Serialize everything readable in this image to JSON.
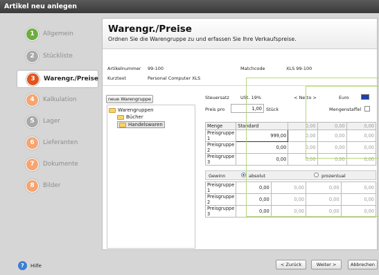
{
  "window": {
    "title": "Artikel neu anlegen"
  },
  "steps": [
    {
      "num": "1",
      "label": "Allgemein",
      "state": "done"
    },
    {
      "num": "2",
      "label": "Stückliste",
      "state": "done-gray"
    },
    {
      "num": "3",
      "label": "Warengr./Preise",
      "state": "active"
    },
    {
      "num": "4",
      "label": "Kalkulation",
      "state": "todo"
    },
    {
      "num": "5",
      "label": "Lager",
      "state": "done-gray"
    },
    {
      "num": "6",
      "label": "Lieferanten",
      "state": "todo"
    },
    {
      "num": "7",
      "label": "Dokumente",
      "state": "todo"
    },
    {
      "num": "8",
      "label": "Bilder",
      "state": "todo"
    }
  ],
  "header": {
    "title": "Warengr./Preise",
    "subtitle": "Ordnen Sie die Warengruppe zu und erfassen Sie Ihre Verkaufspreise."
  },
  "article": {
    "nr_label": "Artikelnummer",
    "nr_value": "99-100",
    "match_label": "Matchcode",
    "match_value": "XLS 99-100",
    "kurz_label": "Kurztext",
    "kurz_value": "Personal Computer XLS"
  },
  "new_group_button": "neue Warengruppe",
  "tree": {
    "root": "Warengruppen",
    "children": [
      "Bücher",
      "Handelswaren"
    ]
  },
  "tax": {
    "label": "Steuersatz",
    "value": "USt. 19%",
    "netto": "< Netto >",
    "currency": "Euro"
  },
  "price_per": {
    "label": "Preis pro",
    "value": "1,00",
    "unit": "Stück",
    "staffel_label": "Mengenstaffel"
  },
  "price_table": {
    "head": [
      "Menge",
      "Standard",
      "0,00",
      "0,00",
      "0,00"
    ],
    "rows": [
      {
        "label": "Preisgruppe 1",
        "values": [
          "999,00",
          "0,00",
          "0,00",
          "0,00"
        ]
      },
      {
        "label": "Preisgruppe 2",
        "values": [
          "0,00",
          "0,00",
          "0,00",
          "0,00"
        ]
      },
      {
        "label": "Preisgruppe 3",
        "values": [
          "0,00",
          "0,00",
          "0,00",
          "0,00"
        ]
      }
    ]
  },
  "profit": {
    "label": "Gewinn",
    "opt_abs": "absolut",
    "opt_pct": "prozentual"
  },
  "profit_table": {
    "rows": [
      {
        "label": "Preisgruppe 1",
        "values": [
          "0,00",
          "0,00",
          "0,00",
          "0,00"
        ]
      },
      {
        "label": "Preisgruppe 2",
        "values": [
          "0,00",
          "0,00",
          "0,00",
          "0,00"
        ]
      },
      {
        "label": "Preisgruppe 3",
        "values": [
          "0,00",
          "0,00",
          "0,00",
          "0,00"
        ]
      }
    ]
  },
  "footer": {
    "help": "Hilfe",
    "back": "< Zurück",
    "next": "Weiter >",
    "cancel": "Abbrechen"
  }
}
